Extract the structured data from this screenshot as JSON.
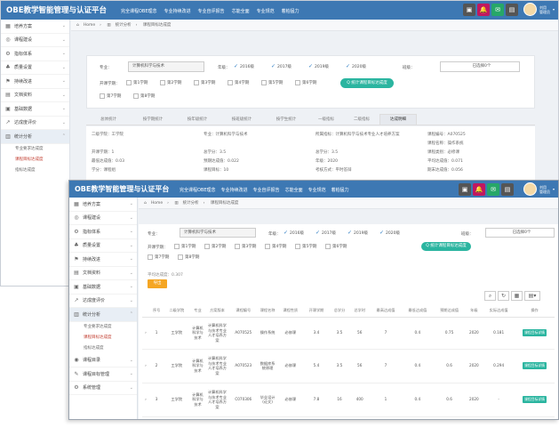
{
  "app": {
    "title": "OBE教学智能管理与认证平台",
    "menu": [
      "完全课程OBE理念",
      "专业持续改进",
      "专业自评报告",
      "芯能全面",
      "专业规范",
      "着柏猛力"
    ],
    "menu2": [
      "完全课程OBE理念",
      "专业持续改进",
      "专业自评报告",
      "芯能全面",
      "专业规范",
      "着柏猛力"
    ],
    "user": {
      "line1": "刘用",
      "line2": "管理员"
    },
    "top_buttons": [
      {
        "icon": "▣",
        "color": "#555"
      },
      {
        "icon": "🔔",
        "color": "#c0185f"
      },
      {
        "icon": "✉",
        "color": "#27a768"
      },
      {
        "icon": "▤",
        "color": "#555"
      }
    ]
  },
  "sidebar": {
    "items": [
      {
        "icon": "▦",
        "label": "培养方案"
      },
      {
        "icon": "◎",
        "label": "课程建设"
      },
      {
        "icon": "⚙",
        "label": "指标体系"
      },
      {
        "icon": "♣",
        "label": "质量设置"
      },
      {
        "icon": "⚑",
        "label": "持续改进"
      },
      {
        "icon": "▤",
        "label": "文档资料"
      },
      {
        "icon": "▣",
        "label": "基础数据"
      },
      {
        "icon": "↗",
        "label": "达成度评价"
      },
      {
        "icon": "▥",
        "label": "统计分析"
      }
    ],
    "subitems": [
      "专业要求达成度",
      "课程目标达成度",
      "指标达成度"
    ],
    "items_after": [
      {
        "icon": "◉",
        "label": "课程目录"
      },
      {
        "icon": "✎",
        "label": "课程目标管理"
      },
      {
        "icon": "⚙",
        "label": "系统管理"
      },
      {
        "icon": "▣",
        "label": "日志与数据统计"
      }
    ]
  },
  "breadcrumb": {
    "home": "Home",
    "section": "统计分析",
    "page": "课程目标达成度"
  },
  "filters": {
    "major_label": "专业：",
    "major_value": "计算机科学与技术",
    "grade_label": "年级：",
    "grades": [
      "2016级",
      "2017级",
      "2019级",
      "2020级"
    ],
    "class_label": "班级：",
    "class_value": "已选择0个",
    "semester_label": "开课学期：",
    "semesters": [
      "第1学期",
      "第2学期",
      "第3学期",
      "第4学期",
      "第5学期",
      "第6学期",
      "第7学期",
      "第8学期"
    ],
    "query_button": "Q 统计课程目标达成度"
  },
  "tabs": [
    "总体统计",
    "按学期统计",
    "按年级统计",
    "按班级统计",
    "按学生统计",
    "一级指标",
    "二级指标",
    "达成明细"
  ],
  "details": {
    "rows": [
      [
        "二级学院：工学院",
        "专业：计算机科学与技术",
        "所属指标：计算机科学与技术专业人才培养方案",
        "课程编号：A070525"
      ],
      [
        "",
        "",
        "",
        "课程名称：操作系统"
      ],
      [
        "开课学期：1",
        "总学分：3.5",
        "总学分：3.5",
        "课程类别：必修课"
      ],
      [
        "最低达成值：0.03",
        "预期达成值：0.022",
        "年级：2020",
        "平均达成值：0.071"
      ],
      [
        "学分：课程组",
        "课程目标：10",
        "考核方式：平时答辩",
        "期末达成值：0.056"
      ]
    ]
  },
  "avg_label": "平均达成度：0.307",
  "export_button": "导出",
  "table": {
    "headers": [
      "序号",
      "二级学院",
      "专业",
      "方案版本",
      "课程编号",
      "课程名称",
      "课程性质",
      "开课学期",
      "总学分",
      "总学时",
      "最高达成值",
      "最低达成值",
      "预期达成值",
      "年级",
      "实际达成值",
      "操作"
    ],
    "rows": [
      {
        "no": "1",
        "college": "工学院",
        "major": "计算机科学与技术",
        "plan": "计算机科学与技术专业人才培养方案",
        "code": "A070525",
        "name": "操作系统",
        "nature": "必修课",
        "term": "3.4",
        "credit": "3.5",
        "hours": "56",
        "max": "7",
        "min": "0.4",
        "exp": "0.75",
        "grade": "2020",
        "actual": "0.181",
        "op": "课程目标详情"
      },
      {
        "no": "2",
        "college": "工学院",
        "major": "计算机科学与技术",
        "plan": "计算机科学与技术专业人才培养方案",
        "code": "A070523",
        "name": "数据库系统原理",
        "nature": "必修课",
        "term": "5.4",
        "credit": "3.5",
        "hours": "56",
        "max": "7",
        "min": "0.4",
        "exp": "0.6",
        "grade": "2020",
        "actual": "0.294",
        "op": "课程目标详情"
      },
      {
        "no": "3",
        "college": "工学院",
        "major": "计算机科学与技术",
        "plan": "计算机科学与技术专业人才培养方案",
        "code": "C070306",
        "name": "毕业设计(论文)",
        "nature": "必修课",
        "term": "7.8",
        "credit": "16",
        "hours": "400",
        "max": "1",
        "min": "0.4",
        "exp": "0.6",
        "grade": "2020",
        "actual": "-",
        "op": "课程目标详情"
      }
    ]
  },
  "table_tools": [
    "search-icon",
    "refresh-icon",
    "grid-icon",
    "columns-icon"
  ]
}
